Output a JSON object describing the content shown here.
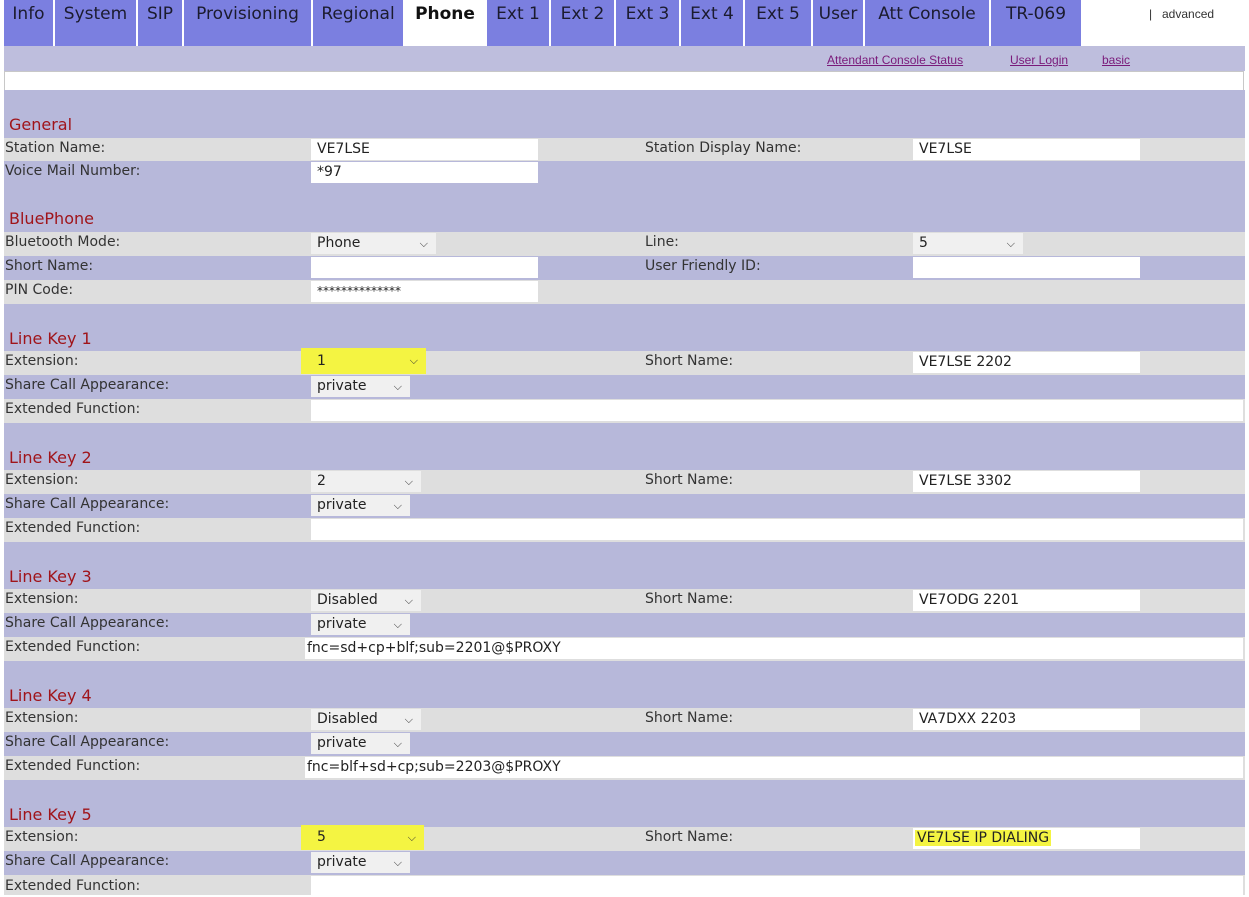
{
  "tabs": [
    {
      "label": "Info"
    },
    {
      "label": "System"
    },
    {
      "label": "SIP"
    },
    {
      "label": "Provisioning"
    },
    {
      "label": "Regional"
    },
    {
      "label": "Phone"
    },
    {
      "label": "Ext 1"
    },
    {
      "label": "Ext 2"
    },
    {
      "label": "Ext 3"
    },
    {
      "label": "Ext 4"
    },
    {
      "label": "Ext 5"
    },
    {
      "label": "User"
    },
    {
      "label": "Att Console"
    },
    {
      "label": "TR-069"
    }
  ],
  "active_tab": "Phone",
  "subbar": {
    "attendant_status": "Attendant Console Status",
    "user_login": "User Login",
    "basic": "basic",
    "separator": "|",
    "advanced": "advanced"
  },
  "general": {
    "title": "General",
    "station_name_label": "Station Name:",
    "station_name": "VE7LSE",
    "station_display_name_label": "Station Display Name:",
    "station_display_name": "VE7LSE",
    "voice_mail_number_label": "Voice Mail Number:",
    "voice_mail_number": "*97"
  },
  "bluephone": {
    "title": "BluePhone",
    "bluetooth_mode_label": "Bluetooth Mode:",
    "bluetooth_mode": "Phone",
    "line_label": "Line:",
    "line": "5",
    "short_name_label": "Short Name:",
    "short_name": "",
    "user_friendly_id_label": "User Friendly ID:",
    "user_friendly_id": "",
    "pin_code_label": "PIN Code:",
    "pin_code": "**************"
  },
  "labels": {
    "extension": "Extension:",
    "short_name": "Short Name:",
    "share_call_appearance": "Share Call Appearance:",
    "extended_function": "Extended Function:"
  },
  "line_keys": [
    {
      "title": "Line Key 1",
      "extension": "1",
      "short_name": "VE7LSE 2202",
      "share": "private",
      "extended_function": ""
    },
    {
      "title": "Line Key 2",
      "extension": "2",
      "short_name": "VE7LSE 3302",
      "share": "private",
      "extended_function": ""
    },
    {
      "title": "Line Key 3",
      "extension": "Disabled",
      "short_name": "VE7ODG 2201",
      "share": "private",
      "extended_function": "fnc=sd+cp+blf;sub=2201@$PROXY"
    },
    {
      "title": "Line Key 4",
      "extension": "Disabled",
      "short_name": "VA7DXX 2203",
      "share": "private",
      "extended_function": "fnc=blf+sd+cp;sub=2203@$PROXY"
    },
    {
      "title": "Line Key 5",
      "extension": "5",
      "short_name": "VE7LSE IP DIALING",
      "share": "private",
      "extended_function": ""
    }
  ],
  "icons": {
    "dropdown": "chevron-down-icon"
  },
  "colors": {
    "tab": "#7b7fe0",
    "band": "#b7b8da",
    "light_row": "#dedede",
    "section_title": "#a0141a",
    "highlight": "#f4f442"
  }
}
